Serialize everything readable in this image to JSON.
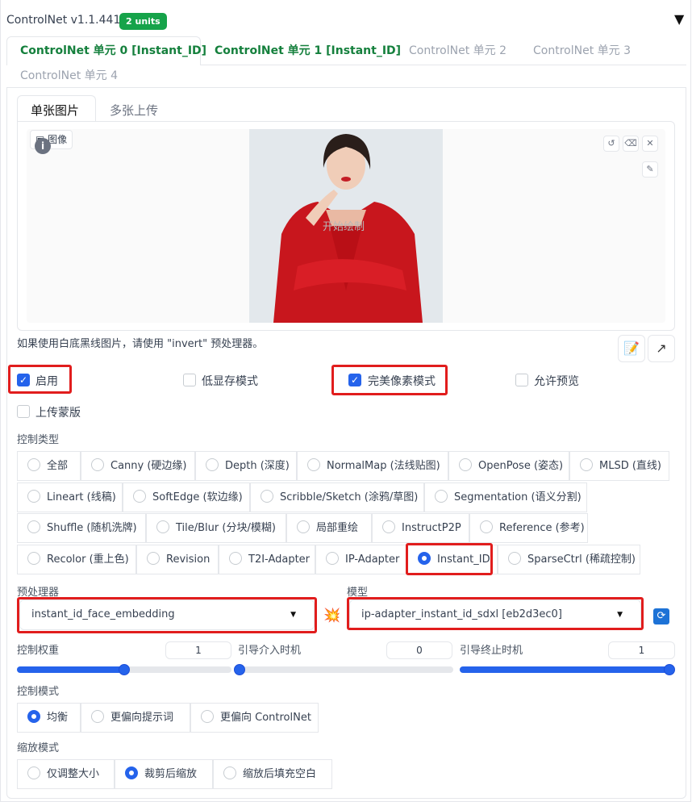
{
  "header": {
    "title": "ControlNet v1.1.441",
    "badge": "2 units"
  },
  "unit_tabs": [
    "ControlNet 单元 0 [Instant_ID]",
    "ControlNet 单元 1 [Instant_ID]",
    "ControlNet 单元 2",
    "ControlNet 单元 3",
    "ControlNet 单元 4"
  ],
  "image_tabs": [
    "单张图片",
    "多张上传"
  ],
  "image_panel": {
    "label": "图像",
    "watermark": "开始绘制"
  },
  "hint": "如果使用白底黑线图片，请使用 \"invert\" 预处理器。",
  "checkboxes": {
    "enable": {
      "label": "启用",
      "checked": true
    },
    "low_vram": {
      "label": "低显存模式",
      "checked": false
    },
    "pixel_perfect": {
      "label": "完美像素模式",
      "checked": true
    },
    "allow_preview": {
      "label": "允许预览",
      "checked": false
    },
    "upload_mask": {
      "label": "上传蒙版",
      "checked": false
    }
  },
  "control_type": {
    "label": "控制类型",
    "options": [
      "全部",
      "Canny (硬边缘)",
      "Depth (深度)",
      "NormalMap (法线贴图)",
      "OpenPose (姿态)",
      "MLSD (直线)",
      "Lineart (线稿)",
      "SoftEdge (软边缘)",
      "Scribble/Sketch (涂鸦/草图)",
      "Segmentation (语义分割)",
      "Shuffle (随机洗牌)",
      "Tile/Blur (分块/模糊)",
      "局部重绘",
      "InstructP2P",
      "Reference (参考)",
      "Recolor (重上色)",
      "Revision",
      "T2I-Adapter",
      "IP-Adapter",
      "Instant_ID",
      "SparseCtrl (稀疏控制)"
    ],
    "selected": "Instant_ID"
  },
  "preprocessor": {
    "label": "预处理器",
    "value": "instant_id_face_embedding"
  },
  "model": {
    "label": "模型",
    "value": "ip-adapter_instant_id_sdxl [eb2d3ec0]"
  },
  "weights": {
    "control_weight": {
      "label": "控制权重",
      "value": "1",
      "fraction": 0.5
    },
    "start": {
      "label": "引导介入时机",
      "value": "0",
      "fraction": 0.0
    },
    "end": {
      "label": "引导终止时机",
      "value": "1",
      "fraction": 1.0
    }
  },
  "control_mode": {
    "label": "控制模式",
    "options": [
      "均衡",
      "更偏向提示词",
      "更偏向 ControlNet"
    ],
    "selected": "均衡"
  },
  "resize_mode": {
    "label": "缩放模式",
    "options": [
      "仅调整大小",
      "裁剪后缩放",
      "缩放后填充空白"
    ],
    "selected": "裁剪后缩放"
  },
  "colors": {
    "accent": "#2563eb",
    "unit_active": "#15803d",
    "highlight": "#e11d1d",
    "badge": "#16a34a"
  }
}
